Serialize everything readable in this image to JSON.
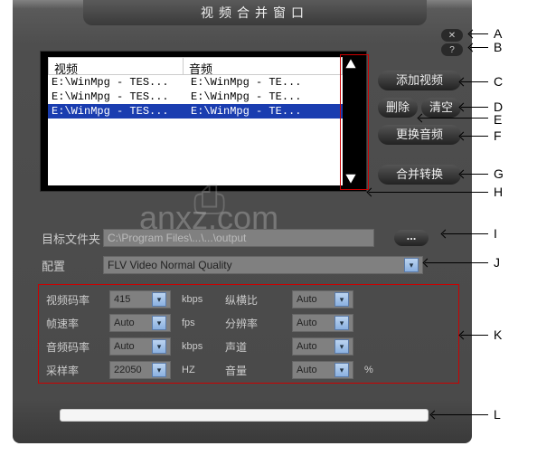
{
  "title": "视频合并窗口",
  "list": {
    "headers": {
      "video": "视频",
      "audio": "音频"
    },
    "rows": [
      {
        "video": "E:\\WinMpg - TES...",
        "audio": "E:\\WinMpg - TE...",
        "selected": false
      },
      {
        "video": "E:\\WinMpg - TES...",
        "audio": "E:\\WinMpg - TE...",
        "selected": false
      },
      {
        "video": "E:\\WinMpg - TES...",
        "audio": "E:\\WinMpg - TE...",
        "selected": true
      }
    ]
  },
  "sideButtons": {
    "add": "添加视频",
    "delete": "删除",
    "clear": "清空",
    "replaceAudio": "更换音频",
    "mergeConvert": "合并转换"
  },
  "targetFolder": {
    "label": "目标文件夹",
    "value": "C:\\Program Files\\...\\...\\output",
    "browse": "..."
  },
  "profile": {
    "label": "配置",
    "value": "FLV Video Normal Quality"
  },
  "params": {
    "videoBitrate": {
      "label": "视频码率",
      "value": "415",
      "unit": "kbps"
    },
    "framerate": {
      "label": "帧速率",
      "value": "Auto",
      "unit": "fps"
    },
    "audioBitrate": {
      "label": "音频码率",
      "value": "Auto",
      "unit": "kbps"
    },
    "sampleRate": {
      "label": "采样率",
      "value": "22050",
      "unit": "HZ"
    },
    "aspect": {
      "label": "纵横比",
      "value": "Auto"
    },
    "resolution": {
      "label": "分辨率",
      "value": "Auto"
    },
    "channels": {
      "label": "声道",
      "value": "Auto"
    },
    "volume": {
      "label": "音量",
      "value": "Auto",
      "unit": "%"
    }
  },
  "callouts": {
    "A": "A",
    "B": "B",
    "C": "C",
    "D": "D",
    "E": "E",
    "F": "F",
    "G": "G",
    "H": "H",
    "I": "I",
    "J": "J",
    "K": "K",
    "L": "L"
  },
  "watermark": "anxz.com"
}
